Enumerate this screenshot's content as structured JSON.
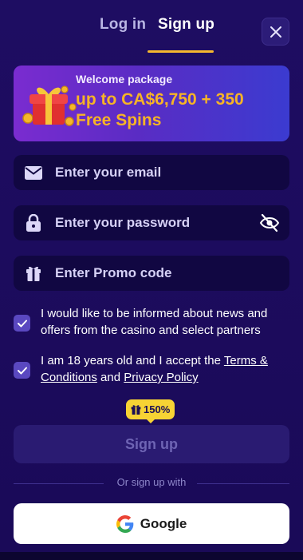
{
  "tabs": {
    "login": "Log in",
    "signup": "Sign up",
    "active": "signup"
  },
  "close_icon": "close-icon",
  "banner": {
    "subtitle": "Welcome package",
    "title_line1": "up to CA$6,750 + 350",
    "title_line2": "Free Spins",
    "icon": "gift-icon"
  },
  "form": {
    "email": {
      "placeholder": "Enter your email",
      "value": "",
      "icon": "envelope-icon"
    },
    "password": {
      "placeholder": "Enter your password",
      "value": "",
      "icon": "lock-icon",
      "toggle_icon": "eye-off-icon"
    },
    "promo": {
      "placeholder": "Enter Promo code",
      "value": "",
      "icon": "gift-icon"
    }
  },
  "consents": {
    "news": {
      "checked": true,
      "text": "I would like to be informed about news and offers from the casino and select partners"
    },
    "age": {
      "checked": true,
      "text_before": "I am 18 years old and I accept the ",
      "terms_link": "Terms & Conditions",
      "text_middle": " and ",
      "privacy_link": "Privacy Policy"
    }
  },
  "bonus_badge": {
    "label": "150%",
    "icon": "gift-icon"
  },
  "signup_button": "Sign up",
  "divider_text": "Or sign up with",
  "google_button": {
    "label": "Google",
    "icon": "google-icon"
  },
  "colors": {
    "background": "#1d0c5e",
    "field": "#110742",
    "accent": "#f6b82f",
    "badge": "#f7d334",
    "checkbox": "#5a48c0"
  }
}
